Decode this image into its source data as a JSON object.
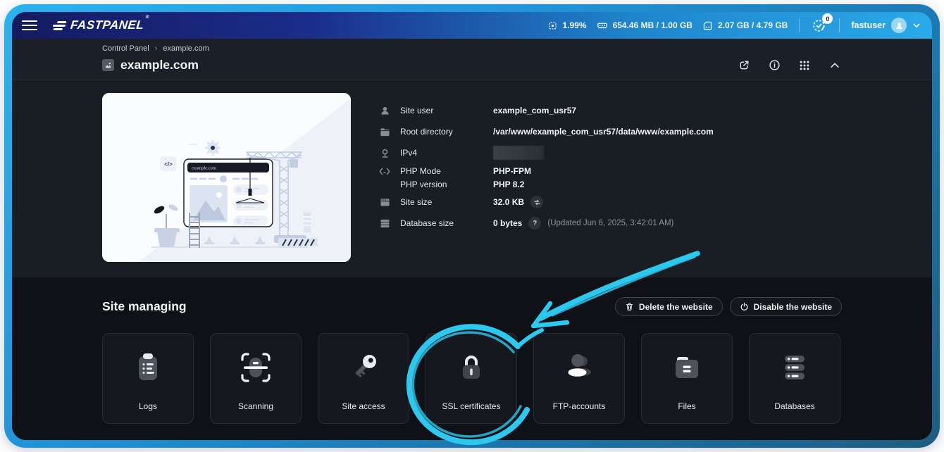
{
  "topbar": {
    "logo": "FASTPANEL",
    "logo_reg": "®",
    "stats": [
      {
        "icon": "cpu-icon",
        "value": "1.99%"
      },
      {
        "icon": "ram-icon",
        "value": "654.46 MB / 1.00 GB"
      },
      {
        "icon": "disk-icon",
        "value": "2.07 GB / 4.79 GB"
      }
    ],
    "notifications_badge": "0",
    "user": "fastuser"
  },
  "header": {
    "breadcrumb": [
      "Control Panel",
      "example.com"
    ],
    "breadcrumb_separator": "›",
    "title": "example.com"
  },
  "site_info": {
    "illustration_url": "example.com",
    "rows": [
      {
        "icon": "user-icon",
        "label": "Site user",
        "value": "example_com_usr57"
      },
      {
        "icon": "folder-icon",
        "label": "Root directory",
        "value": "/var/www/example_com_usr57/data/www/example.com"
      },
      {
        "icon": "location-icon",
        "label": "IPv4",
        "value": "",
        "redacted": true
      },
      {
        "icon": "code-icon",
        "label": "PHP Mode",
        "value": "PHP-FPM"
      },
      {
        "icon": "",
        "label": "PHP version",
        "value": "PHP 8.2"
      },
      {
        "icon": "panel-icon",
        "label": "Site size",
        "value": "32.0 KB"
      },
      {
        "icon": "database-icon",
        "label": "Database size",
        "value": "0 bytes",
        "help": "?",
        "note": "(Updated Jun 6, 2025, 3:42:01 AM)"
      }
    ]
  },
  "site_managing": {
    "heading": "Site managing",
    "buttons": [
      {
        "icon": "trash-icon",
        "label": "Delete the website"
      },
      {
        "icon": "power-icon",
        "label": "Disable the website"
      }
    ],
    "cards": [
      {
        "icon": "logs-icon",
        "label": "Logs"
      },
      {
        "icon": "scanning-icon",
        "label": "Scanning"
      },
      {
        "icon": "key-icon",
        "label": "Site access"
      },
      {
        "icon": "lock-icon",
        "label": "SSL certificates",
        "highlighted": true
      },
      {
        "icon": "users-icon",
        "label": "FTP-accounts"
      },
      {
        "icon": "folder-icon",
        "label": "Files"
      },
      {
        "icon": "databases-icon",
        "label": "Databases"
      }
    ]
  },
  "annotation": {
    "shape": "hand-drawn arrow and circle",
    "target": "SSL certificates",
    "color": "#2cc8ee"
  },
  "colors": {
    "frame_gradient_start": "#2ab3ee",
    "frame_gradient_end": "#1d5c80",
    "topbar_gradient_start": "#141b60",
    "topbar_gradient_end": "#2aa9e8",
    "section_header_bg": "#1b1f27",
    "section_info_bg": "#191d24",
    "section_manage_bg": "#0f1116",
    "card_bg": "#15181e",
    "annotation_accent": "#2cc8ee"
  }
}
